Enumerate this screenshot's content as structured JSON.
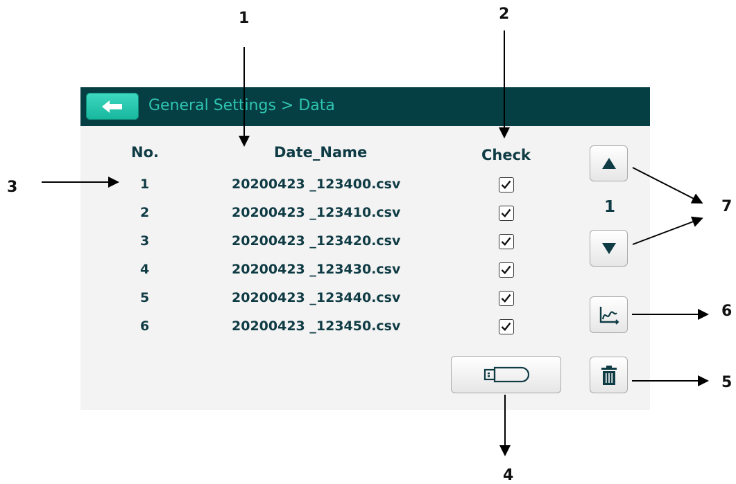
{
  "callouts": [
    "1",
    "2",
    "3",
    "4",
    "5",
    "6",
    "7"
  ],
  "header": {
    "title": "General Settings > Data"
  },
  "table": {
    "col_no": "No.",
    "col_name": "Date_Name",
    "col_check": "Check",
    "rows": [
      {
        "no": "1",
        "name": "20200423 _123400.csv",
        "checked": true
      },
      {
        "no": "2",
        "name": "20200423 _123410.csv",
        "checked": true
      },
      {
        "no": "3",
        "name": "20200423 _123420.csv",
        "checked": true
      },
      {
        "no": "4",
        "name": "20200423 _123430.csv",
        "checked": true
      },
      {
        "no": "5",
        "name": "20200423 _123440.csv",
        "checked": true
      },
      {
        "no": "6",
        "name": "20200423 _123450.csv",
        "checked": true
      }
    ]
  },
  "pager": {
    "page": "1"
  },
  "icons": {
    "back": "back-arrow-icon",
    "up": "up-triangle-icon",
    "down": "down-triangle-icon",
    "chart": "line-chart-icon",
    "delete": "trash-icon",
    "export": "usb-drive-icon"
  },
  "colors": {
    "titlebar": "#053f43",
    "title_text": "#2fc4b0",
    "back_button": "#1fc6ab",
    "text": "#0f3b44",
    "panel": "#f3f3f3"
  }
}
